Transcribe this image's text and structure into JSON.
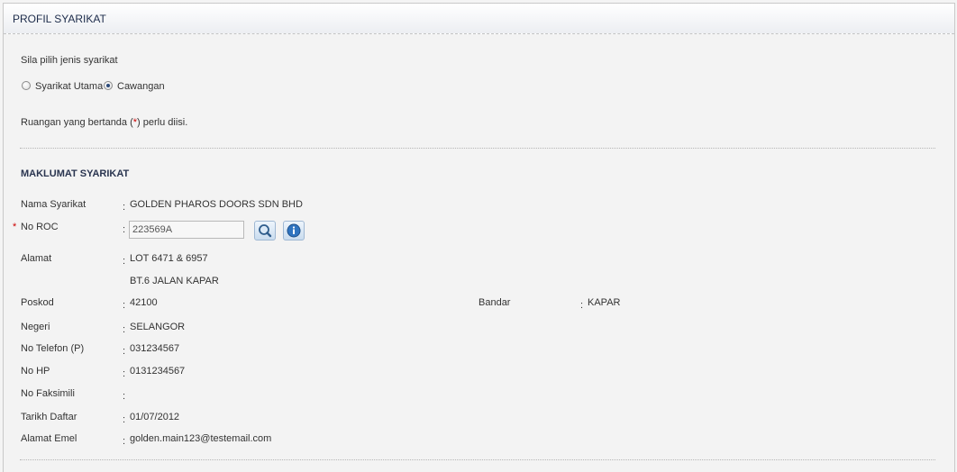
{
  "header": {
    "title": "PROFIL SYARIKAT"
  },
  "company_type": {
    "prompt": "Sila pilih jenis syarikat",
    "options": [
      {
        "label": "Syarikat Utama",
        "selected": false
      },
      {
        "label": "Cawangan",
        "selected": true
      }
    ]
  },
  "required_note": {
    "prefix": "Ruangan yang bertanda (",
    "star": "*",
    "suffix": ") perlu diisi."
  },
  "section": {
    "title": "MAKLUMAT SYARIKAT"
  },
  "fields": {
    "nama_syarikat": {
      "label": "Nama Syarikat",
      "value": "GOLDEN PHAROS DOORS SDN BHD"
    },
    "no_roc": {
      "required_mark": "*",
      "label": "No ROC",
      "value": "223569A"
    },
    "alamat": {
      "label": "Alamat",
      "line1": "LOT 6471 & 6957",
      "line2": "BT.6 JALAN KAPAR"
    },
    "poskod": {
      "label": "Poskod",
      "value": "42100"
    },
    "bandar": {
      "label": "Bandar",
      "value": "KAPAR"
    },
    "negeri": {
      "label": "Negeri",
      "value": "SELANGOR"
    },
    "no_telefon": {
      "label": "No Telefon (P)",
      "value": "031234567"
    },
    "no_hp": {
      "label": "No HP",
      "value": "0131234567"
    },
    "no_faksimili": {
      "label": "No Faksimili",
      "value": ""
    },
    "tarikh_daftar": {
      "label": "Tarikh Daftar",
      "value": "01/07/2012"
    },
    "alamat_emel": {
      "label": "Alamat Emel",
      "value": "golden.main123@testemail.com"
    }
  },
  "colon": ":",
  "icons": {
    "search": "search-icon",
    "info": "info-icon"
  },
  "colors": {
    "required": "#cc0000",
    "title": "#1c2b4a"
  }
}
